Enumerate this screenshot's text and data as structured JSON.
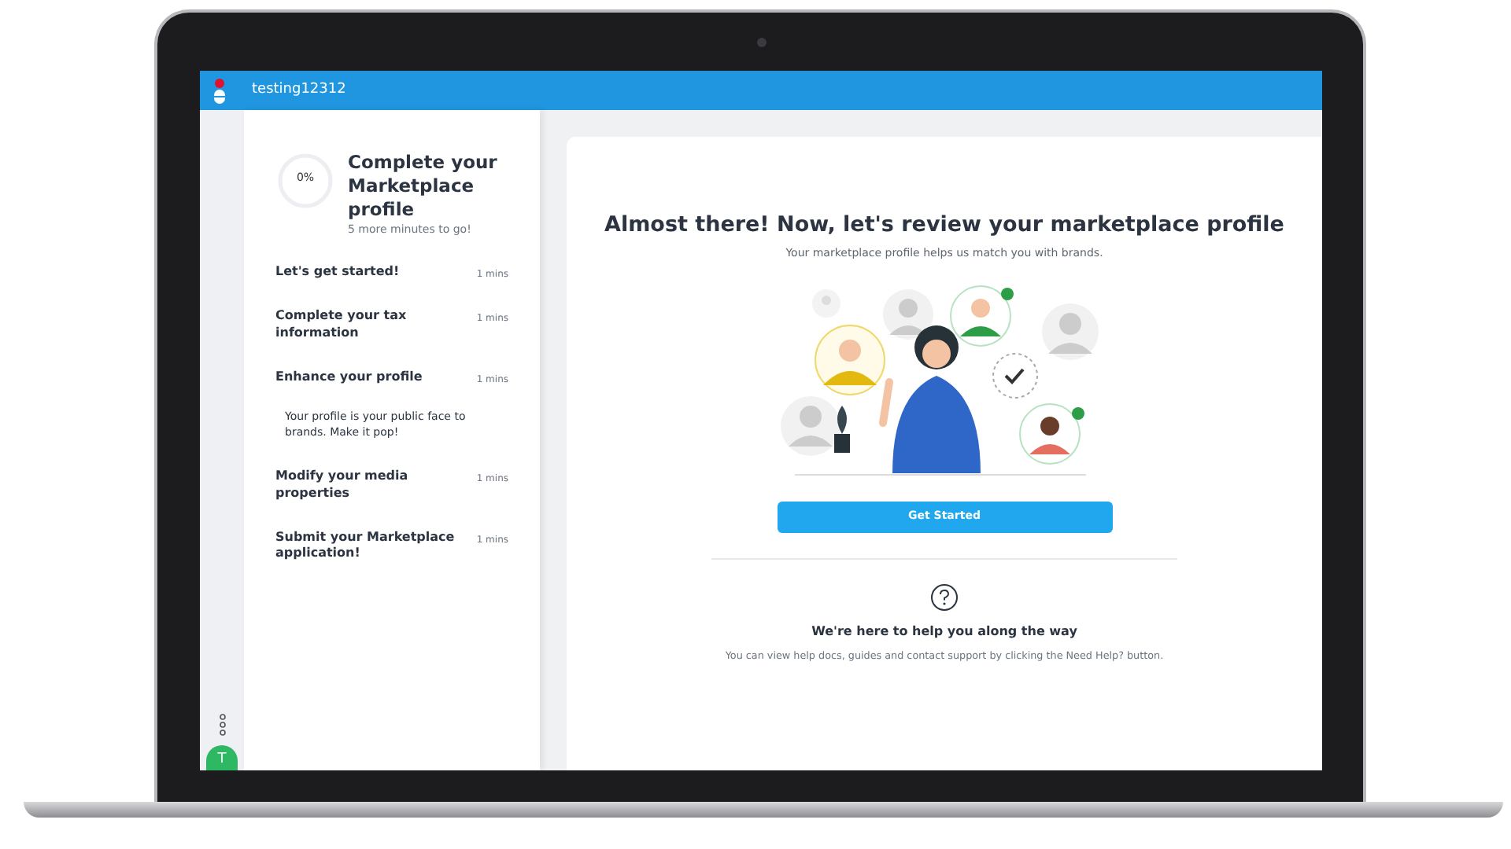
{
  "app_bar": {
    "title": "testing12312"
  },
  "rail": {
    "avatar_initial": "T"
  },
  "progress_panel": {
    "percent": "0%",
    "level": 0,
    "title": "Complete your Marketplace profile",
    "subtitle": "5 more minutes to go!",
    "steps": [
      {
        "title": "Let's get started!",
        "duration": "1 mins"
      },
      {
        "title": "Complete your tax information",
        "duration": "1 mins"
      },
      {
        "title": "Enhance your profile",
        "duration": "1 mins",
        "description": "Your profile is your public face to brands. Make it pop!"
      },
      {
        "title": "Modify your media properties",
        "duration": "1 mins"
      },
      {
        "title": "Submit your Marketplace application!",
        "duration": "1 mins"
      }
    ]
  },
  "main": {
    "heading": "Almost there! Now, let's review your marketplace profile",
    "subheading": "Your marketplace profile helps us match you with brands.",
    "button": "Get Started",
    "help": {
      "title": "We're here to help you along the way",
      "text": "You can view help docs, guides and contact support by clicking the Need Help? button."
    }
  }
}
